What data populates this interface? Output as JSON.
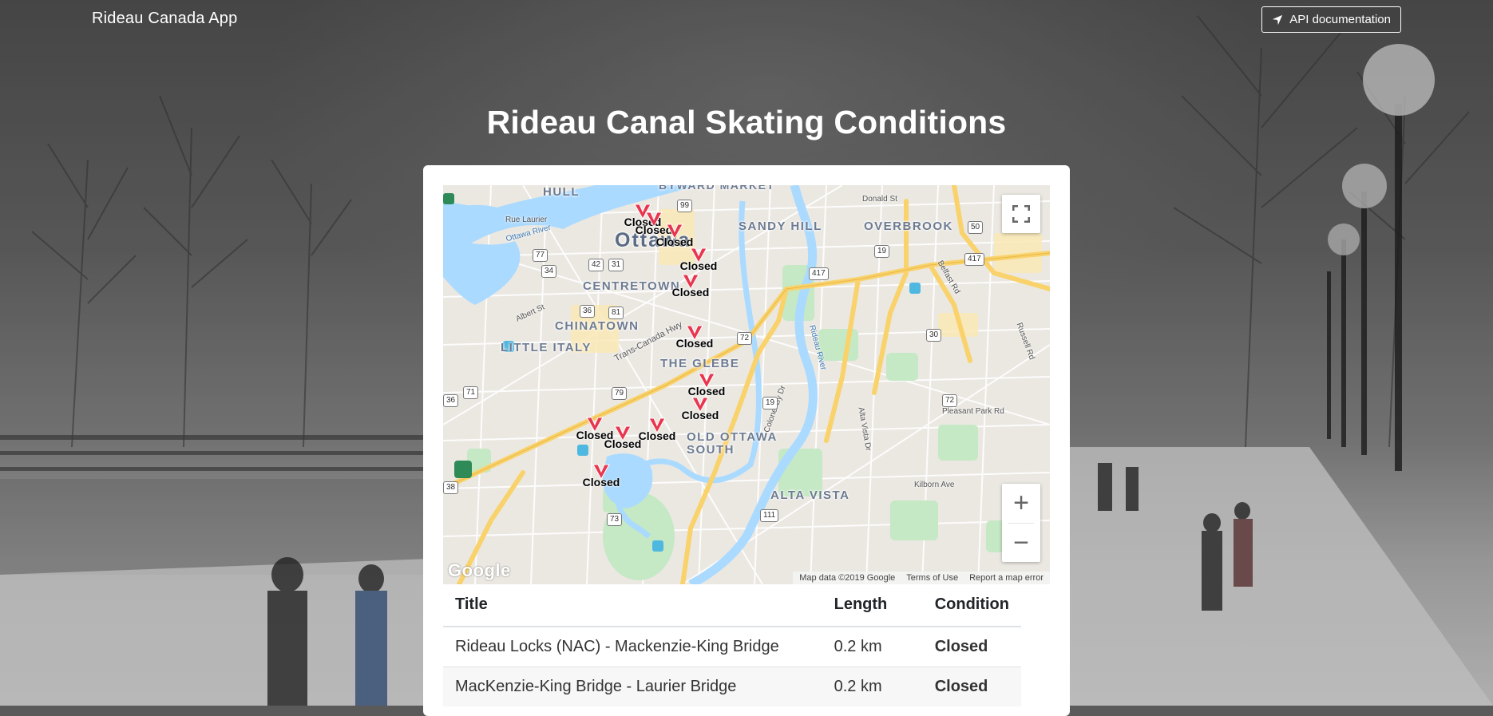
{
  "header": {
    "brand": "Rideau Canada App",
    "api_button_label": "API documentation",
    "api_icon": "location-arrow-icon"
  },
  "page": {
    "title": "Rideau Canal Skating Conditions"
  },
  "map": {
    "area_labels": {
      "ottawa": "Ottawa",
      "hull": "HULL",
      "byward_market": "BYWARD MARKET",
      "sandy_hill": "SANDY HILL",
      "overbrook": "OVERBROOK",
      "centretown": "CENTRETOWN",
      "chinatown": "CHINATOWN",
      "little_italy": "LITTLE ITALY",
      "the_glebe": "THE GLEBE",
      "old_ottawa_south": "OLD OTTAWA SOUTH",
      "alta_vista": "ALTA VISTA"
    },
    "road_labels": {
      "ottawa_river": "Ottawa River",
      "rue_laurier": "Rue Laurier",
      "albert_st": "Albert St",
      "trans_canada": "Trans-Canada Hwy",
      "rideau_river": "Rideau River",
      "donald_st": "Donald St",
      "belfast_rd": "Belfast Rd",
      "russell_rd": "Russell Rd",
      "pleasant_park": "Pleasant Park Rd",
      "kilborn": "Kilborn Ave",
      "alta_vista_dr": "Alta Vista Dr",
      "colonel_by": "Colonel By Dr"
    },
    "route_shields": [
      "99",
      "77",
      "34",
      "42",
      "31",
      "36",
      "81",
      "72",
      "417",
      "19",
      "50",
      "30",
      "79",
      "71",
      "73",
      "111",
      "38",
      "36",
      "19",
      "72",
      "417"
    ],
    "markers_label": "Closed",
    "marker_count": 13,
    "fullscreen_icon": "fullscreen-icon",
    "zoom_in_label": "+",
    "zoom_out_label": "−",
    "logo_text": "Google",
    "attribution": {
      "map_data": "Map data ©2019 Google",
      "terms": "Terms of Use",
      "report": "Report a map error"
    }
  },
  "table": {
    "headers": {
      "title": "Title",
      "length": "Length",
      "condition": "Condition"
    },
    "rows": [
      {
        "title": "Rideau Locks (NAC) - Mackenzie-King Bridge",
        "length": "0.2 km",
        "condition": "Closed"
      },
      {
        "title": "MacKenzie-King Bridge - Laurier Bridge",
        "length": "0.2 km",
        "condition": "Closed"
      }
    ]
  },
  "colors": {
    "accent_closed": "#e8364f",
    "marker": "#e8364f",
    "water": "#aadaff",
    "park": "#c5e8c5",
    "highway": "#f9d26b"
  }
}
